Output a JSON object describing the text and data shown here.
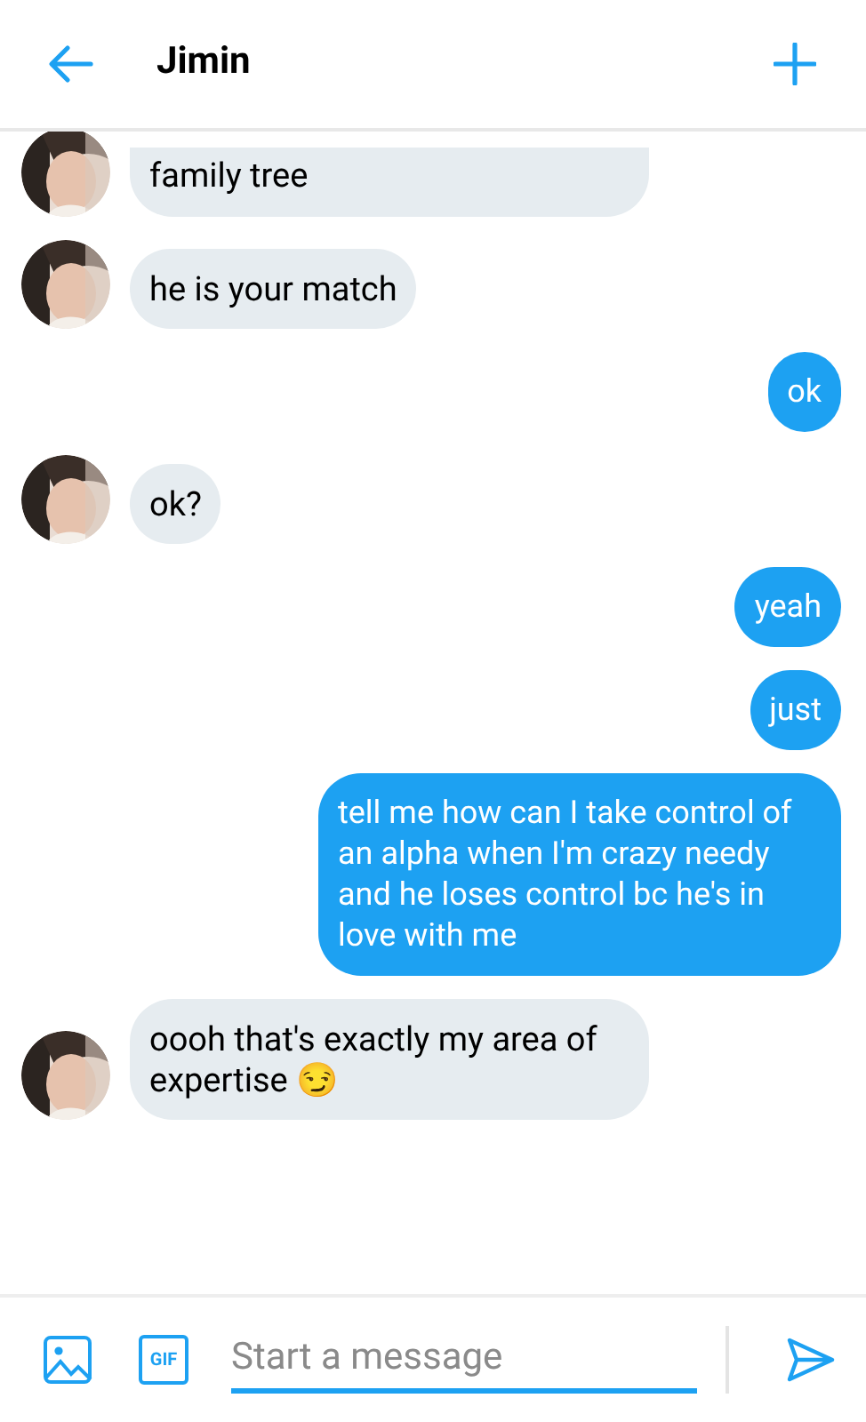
{
  "header": {
    "title": "Jimin"
  },
  "messages": [
    {
      "kind": "received",
      "text": "family tree",
      "cut": true
    },
    {
      "kind": "received",
      "text": "he is your match"
    },
    {
      "kind": "sent",
      "text": "ok"
    },
    {
      "kind": "received",
      "text": "ok?"
    },
    {
      "kind": "sent",
      "text": "yeah"
    },
    {
      "kind": "sent",
      "text": "just"
    },
    {
      "kind": "sent",
      "text": "tell me how can I take control of an alpha when I'm crazy needy and he loses control bc he's in love with me"
    },
    {
      "kind": "received",
      "text": "oooh that's exactly my area of expertise 😏"
    }
  ],
  "composer": {
    "gif_label": "GIF",
    "placeholder": "Start a message"
  }
}
